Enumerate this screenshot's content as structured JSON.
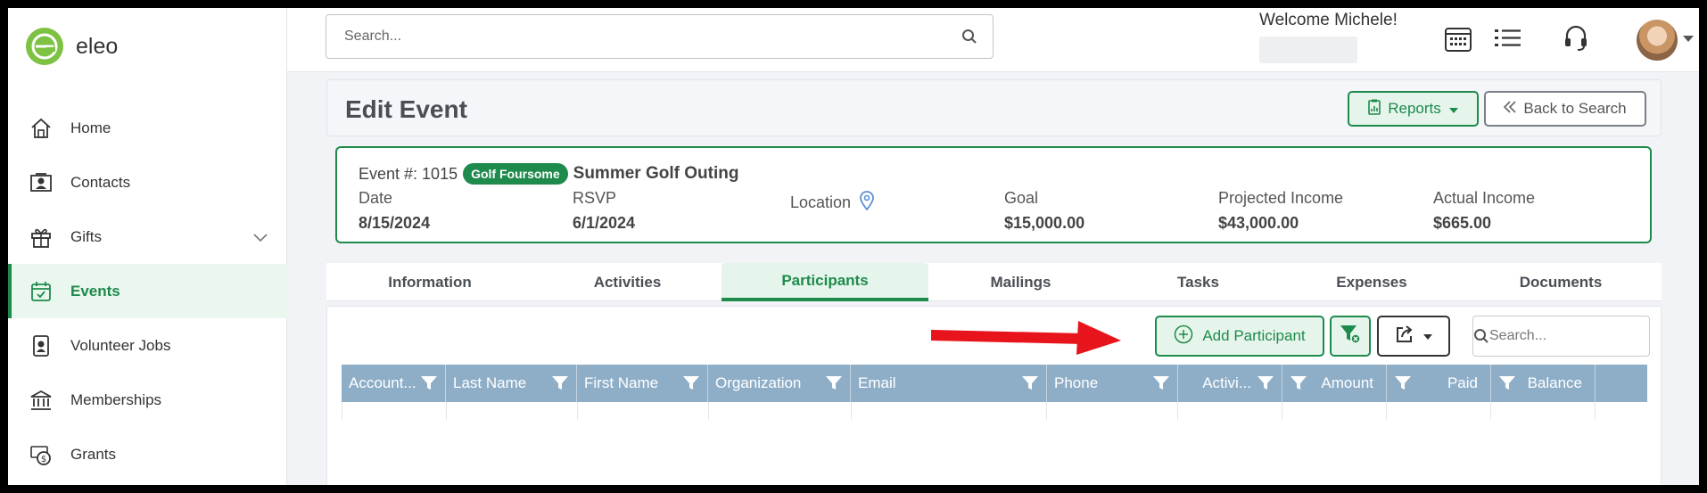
{
  "app": {
    "name": "eleo"
  },
  "sidebar": {
    "items": [
      {
        "label": "Home",
        "icon": "home-icon"
      },
      {
        "label": "Contacts",
        "icon": "contacts-icon"
      },
      {
        "label": "Gifts",
        "icon": "gift-icon"
      },
      {
        "label": "Events",
        "icon": "calendar-check-icon"
      },
      {
        "label": "Volunteer Jobs",
        "icon": "badge-icon"
      },
      {
        "label": "Memberships",
        "icon": "bank-icon"
      },
      {
        "label": "Grants",
        "icon": "money-icon"
      }
    ]
  },
  "topbar": {
    "search_placeholder": "Search...",
    "welcome": "Welcome Michele!"
  },
  "header": {
    "title": "Edit Event",
    "reports_label": "Reports",
    "back_label": "Back to Search"
  },
  "event": {
    "number_label": "Event #: 1015",
    "type_badge": "Golf Foursome",
    "name": "Summer Golf Outing",
    "fields": [
      {
        "label": "Date",
        "value": "8/15/2024"
      },
      {
        "label": "RSVP",
        "value": "6/1/2024"
      },
      {
        "label": "Location",
        "value": ""
      },
      {
        "label": "Goal",
        "value": "$15,000.00"
      },
      {
        "label": "Projected Income",
        "value": "$43,000.00"
      },
      {
        "label": "Actual Income",
        "value": "$665.00"
      }
    ]
  },
  "tabs": [
    {
      "label": "Information",
      "active": false
    },
    {
      "label": "Activities",
      "active": false
    },
    {
      "label": "Participants",
      "active": true
    },
    {
      "label": "Mailings",
      "active": false
    },
    {
      "label": "Tasks",
      "active": false
    },
    {
      "label": "Expenses",
      "active": false
    },
    {
      "label": "Documents",
      "active": false
    }
  ],
  "grid": {
    "add_label": "Add Participant",
    "search_placeholder": "Search...",
    "columns": [
      "Account...",
      "Last Name",
      "First Name",
      "Organization",
      "Email",
      "Phone",
      "Activi...",
      "Amount",
      "Paid",
      "Balance"
    ]
  },
  "colors": {
    "accent": "#1e8a4c",
    "header_bg": "#8eaec8",
    "annotation_arrow": "#e8141b"
  }
}
